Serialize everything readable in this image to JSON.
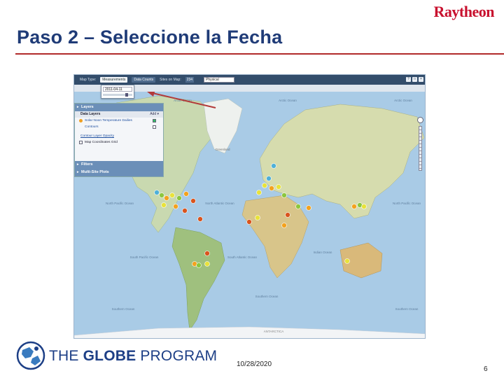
{
  "slide": {
    "title": "Paso 2 – Seleccione la Fecha",
    "brand": "Raytheon",
    "date": "10/28/2020",
    "page_number": "6",
    "program_name_light": "THE ",
    "program_name_bold": "GLOBE",
    "program_name_end": " PROGRAM"
  },
  "app": {
    "toolbar": {
      "map_type_label": "Map Type:",
      "tab_measurements": "Measurements",
      "tab_data_counts": "Data Counts",
      "sites_label": "Sites on Map:",
      "sites_count": "234",
      "map_style": "Physical",
      "help_icon": "?",
      "window_icon": "□",
      "close_icon": "×"
    },
    "date_picker": {
      "value": "2011-04-11"
    },
    "panel": {
      "layers_header": "Layers",
      "data_layers_label": "Data Layers",
      "add_label": "Add ▾",
      "layer_solar": "Solar Noon Temperature Dailies",
      "layer_contours": "Contours",
      "contour_opacity_link": "Contour Layer Opacity",
      "map_grid_label": "Map Coordinates Grid",
      "filters_header": "Filters",
      "multi_site_header": "Multi-Site Plots"
    },
    "map_labels": {
      "arctic_ocean_1": "Arctic Ocean",
      "arctic_ocean_2": "Arctic Ocean",
      "arctic_ocean_3": "Arctic Ocean",
      "greenland": "Greenland",
      "north_pacific_w": "North Pacific Ocean",
      "north_atlantic": "North Atlantic Ocean",
      "north_pacific_e": "North Pacific Ocean",
      "south_pacific": "South Pacific Ocean",
      "south_atlantic": "South Atlantic Ocean",
      "indian_ocean": "Indian Ocean",
      "southern_ocean_1": "Southern Ocean",
      "southern_ocean_2": "Southern Ocean",
      "southern_ocean_3": "Southern Ocean",
      "antarctica": "ANTARCTICA"
    },
    "marker_colors": [
      "#f3a21e",
      "#8cc63f",
      "#e8e23a",
      "#d9541e",
      "#4fb0d8"
    ]
  }
}
